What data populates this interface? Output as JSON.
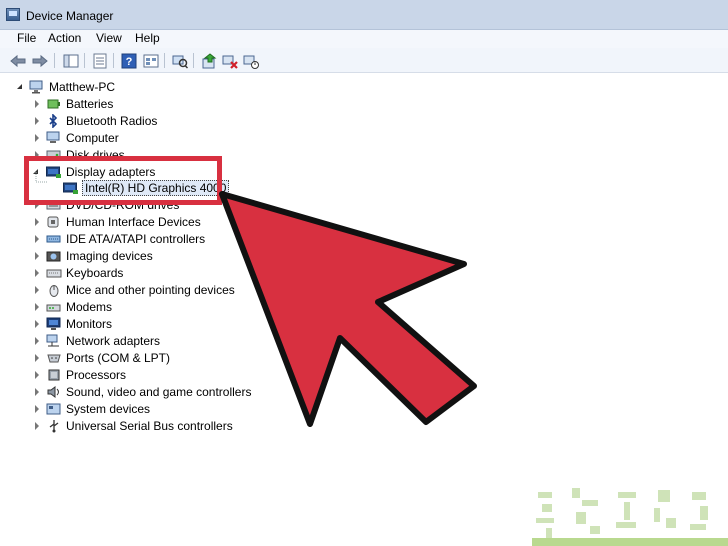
{
  "window": {
    "title": "Device Manager"
  },
  "menu": {
    "file": "File",
    "action": "Action",
    "view": "View",
    "help": "Help"
  },
  "toolbar": {
    "buttons": [
      "back-icon",
      "forward-icon",
      "show-hide-tree-icon",
      "properties-icon",
      "help-icon",
      "view-icon",
      "scan-hardware-icon",
      "update-driver-icon",
      "uninstall-icon",
      "disable-icon"
    ]
  },
  "tree": {
    "root": "Matthew-PC",
    "categories": [
      {
        "label": "Batteries",
        "icon": "battery-icon"
      },
      {
        "label": "Bluetooth Radios",
        "icon": "bluetooth-icon"
      },
      {
        "label": "Computer",
        "icon": "computer-icon"
      },
      {
        "label": "Disk drives",
        "icon": "disk-icon"
      },
      {
        "label": "Display adapters",
        "icon": "display-adapter-icon"
      },
      {
        "label": "DVD/CD-ROM drives",
        "icon": "dvd-icon"
      },
      {
        "label": "Human Interface Devices",
        "icon": "hid-icon"
      },
      {
        "label": "IDE ATA/ATAPI controllers",
        "icon": "ide-icon"
      },
      {
        "label": "Imaging devices",
        "icon": "camera-icon"
      },
      {
        "label": "Keyboards",
        "icon": "keyboard-icon"
      },
      {
        "label": "Mice and other pointing devices",
        "icon": "mouse-icon"
      },
      {
        "label": "Modems",
        "icon": "modem-icon"
      },
      {
        "label": "Monitors",
        "icon": "monitor-icon"
      },
      {
        "label": "Network adapters",
        "icon": "network-icon"
      },
      {
        "label": "Ports (COM & LPT)",
        "icon": "port-icon"
      },
      {
        "label": "Processors",
        "icon": "processor-icon"
      },
      {
        "label": "Sound, video and game controllers",
        "icon": "sound-icon"
      },
      {
        "label": "System devices",
        "icon": "system-icon"
      },
      {
        "label": "Universal Serial Bus controllers",
        "icon": "usb-icon"
      }
    ],
    "child": {
      "label": "Intel(R) HD Graphics 4000",
      "icon": "display-adapter-icon"
    }
  },
  "colors": {
    "highlight": "#d83040",
    "arrow": "#d83040",
    "selection": "#dfe9f7"
  }
}
